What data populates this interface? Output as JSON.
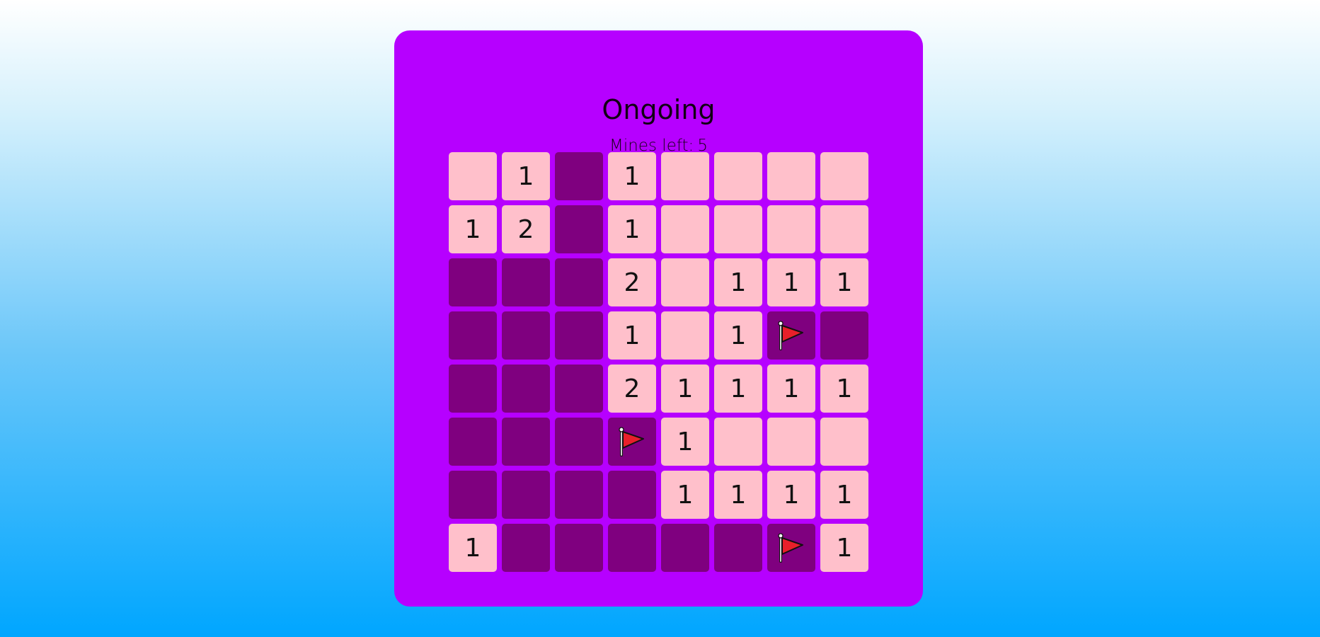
{
  "game": {
    "status": "Ongoing",
    "mines_left_label": "Mines left:",
    "mines_left": "5"
  },
  "colors": {
    "background_top": "#ffffff",
    "background_bottom": "#00a6ff",
    "panel": "#b600ff",
    "revealed_cell": "#ffc0cb",
    "hidden_cell": "#7f007f",
    "flag": "#e8202a"
  },
  "board": {
    "rows": 8,
    "cols": 8,
    "legend": {
      "O": "revealed-empty",
      "H": "hidden",
      "F": "flagged",
      "1-8": "revealed-number"
    },
    "cells": [
      [
        "O",
        "1",
        "H",
        "1",
        "O",
        "O",
        "O",
        "O"
      ],
      [
        "1",
        "2",
        "H",
        "1",
        "O",
        "O",
        "O",
        "O"
      ],
      [
        "H",
        "H",
        "H",
        "2",
        "O",
        "1",
        "1",
        "1"
      ],
      [
        "H",
        "H",
        "H",
        "1",
        "O",
        "1",
        "F",
        "H"
      ],
      [
        "H",
        "H",
        "H",
        "2",
        "1",
        "1",
        "1",
        "1"
      ],
      [
        "H",
        "H",
        "H",
        "F",
        "1",
        "O",
        "O",
        "O"
      ],
      [
        "H",
        "H",
        "H",
        "H",
        "1",
        "1",
        "1",
        "1"
      ],
      [
        "1",
        "H",
        "H",
        "H",
        "H",
        "H",
        "F",
        "1"
      ]
    ]
  }
}
